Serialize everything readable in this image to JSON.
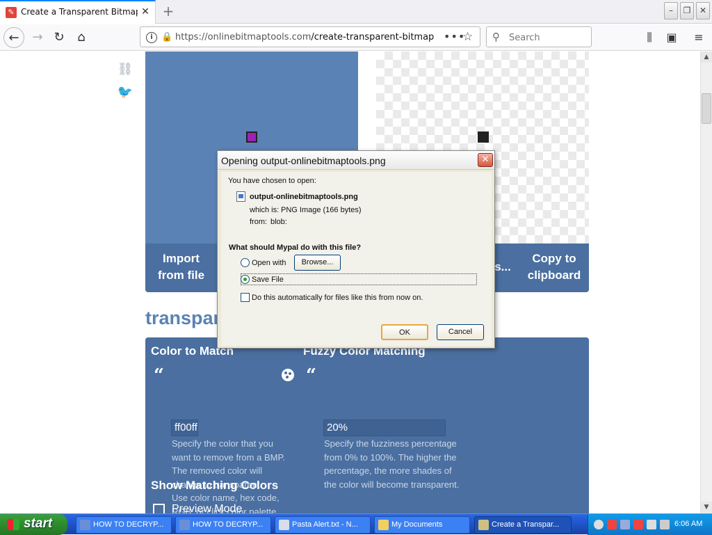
{
  "browser": {
    "tab_title": "Create a Transparent Bitmap - Onl",
    "url_host": "https://onlinebitmaptools.com",
    "url_path": "/create-transparent-bitmap",
    "search_placeholder": "Search"
  },
  "page": {
    "buttons": {
      "import_line1": "Import",
      "import_line2": "from file",
      "save_partial": "s...",
      "copy_line1": "Copy to",
      "copy_line2": "clipboard"
    },
    "section_title": "transpare",
    "color_match": {
      "heading": "Color to Match",
      "value": "ff00ff",
      "desc_lines": [
        "Specify the color that you",
        "want to remove from a BMP.",
        "The removed color will",
        "change to transparent.",
        "Use color name, hex code,",
        "RGB, or click color palette."
      ]
    },
    "fuzzy": {
      "heading": "Fuzzy Color Matching",
      "value": "20%",
      "desc_lines": [
        "Specify the fuzziness percentage",
        "from 0% to 100%. The higher the",
        "percentage, the more shades of",
        "the color will become transparent."
      ]
    },
    "show_matching": {
      "heading": "Show Matching Colors",
      "preview_label": "Preview Mode"
    }
  },
  "dialog": {
    "title": "Opening output-onlinebitmaptools.png",
    "intro": "You have chosen to open:",
    "filename": "output-onlinebitmaptools.png",
    "which_is_label": "which is:",
    "which_is_value": "PNG Image (166 bytes)",
    "from_label": "from:",
    "from_value": "blob:",
    "question": "What should Mypal do with this file?",
    "open_with_label": "Open with",
    "browse_label": "Browse...",
    "save_file_label": "Save File",
    "auto_label": "Do this automatically for files like this from now on.",
    "ok_label": "OK",
    "cancel_label": "Cancel",
    "selected_option": "Save File"
  },
  "taskbar": {
    "start_label": "start",
    "tasks": [
      {
        "label": "HOW TO DECRYP...",
        "color": "#6b8fd6"
      },
      {
        "label": "HOW TO DECRYP...",
        "color": "#6b8fd6"
      },
      {
        "label": "Pasta Alert.txt - N...",
        "color": "#d8dde8"
      },
      {
        "label": "My Documents",
        "color": "#f2d060"
      },
      {
        "label": "Create a Transpar...",
        "color": "#d0c080"
      }
    ],
    "clock": "6:06 AM"
  },
  "colors": {
    "panel_blue": "#5b82b4",
    "button_row_blue": "#4a6fa0",
    "accent_green": "#12bc00"
  }
}
